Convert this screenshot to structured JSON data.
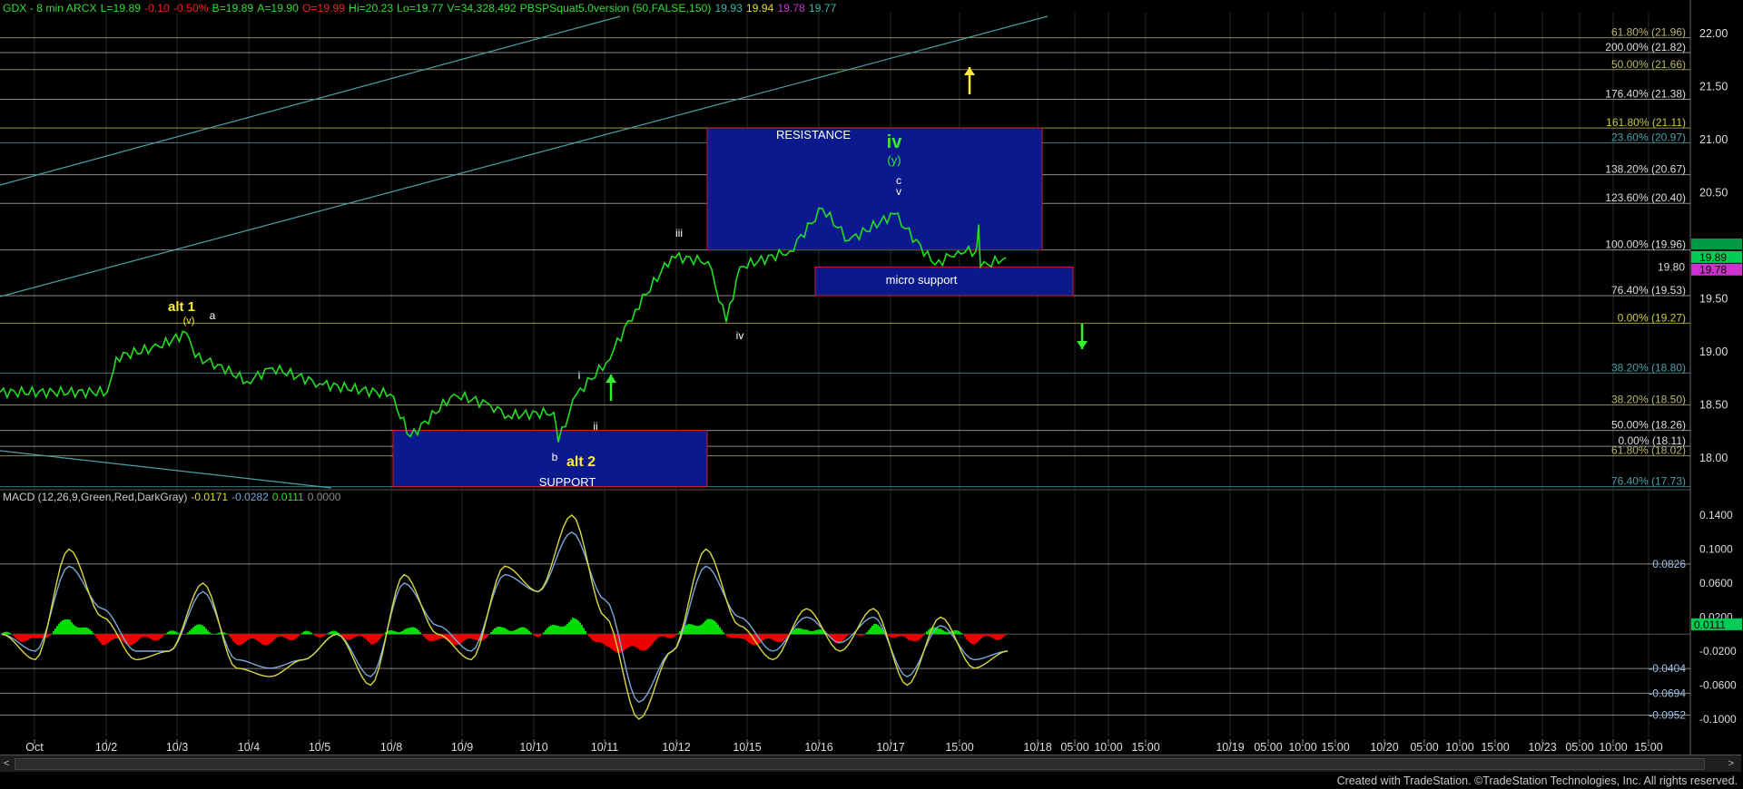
{
  "header": {
    "symbol": "GDX - 8 min  ARCX",
    "last": "L=19.89",
    "change": "-0.10",
    "change_pct": "-0.50%",
    "bid": "B=19.89",
    "ask": "A=19.90",
    "open": "O=19.99",
    "high": "Hi=20.23",
    "low": "Lo=19.77",
    "volume": "V=34,328,492",
    "study": "PBSPSquat5.0version (50,FALSE,150)",
    "study_v1": "19.93",
    "study_v2": "19.94",
    "study_v3": "19.78",
    "study_v4": "19.77"
  },
  "macd_header": {
    "label": "MACD (12,26,9,Green,Red,DarkGray)",
    "v1": "-0.0171",
    "v2": "-0.0282",
    "v3": "0.0111",
    "v4": "0.0000"
  },
  "footer": "Created with TradeStation. ©TradeStation Technologies, Inc. All rights reserved.",
  "scrollbar": {
    "left": "<",
    "right": ">"
  },
  "colors": {
    "background": "#000000",
    "price": "#22dd22",
    "box": "#0a1a8c",
    "box_border": "#cc2222",
    "label_yellow": "#ffee33",
    "label_green": "#33ee33",
    "fib_khaki": "#b8b870",
    "fib_cyan": "#4aa0a8",
    "macd_line": "#d8d840",
    "signal_line": "#7aa7d8",
    "hist_pos": "#00dd00",
    "hist_neg": "#ee0000"
  },
  "chart_data": [
    {
      "type": "line",
      "name": "price",
      "x_ticks": [
        "Oct",
        "10/2",
        "10/3",
        "10/4",
        "10/5",
        "10/8",
        "10/9",
        "10/10",
        "10/11",
        "10/12",
        "10/15",
        "10/16",
        "10/17",
        "15:00",
        "10/18",
        "05:00",
        "10:00",
        "15:00",
        "10/19",
        "05:00",
        "10:00",
        "15:00",
        "10/20",
        "05:00",
        "10:00",
        "15:00",
        "10/23",
        "05:00",
        "10:00",
        "15:00"
      ],
      "y_ticks": [
        18.0,
        18.5,
        19.0,
        19.5,
        20.0,
        20.5,
        21.0,
        21.5,
        22.0
      ],
      "ylim": [
        17.73,
        22.1
      ],
      "last_price": 19.89,
      "price_tags": [
        {
          "label": "19.89",
          "color": "#00cc55"
        },
        {
          "label": "19.78",
          "color": "#cc33cc"
        },
        {
          "label": "19.80",
          "color": "#000000"
        }
      ],
      "path_points": [
        {
          "x": "Oct",
          "y": 18.62
        },
        {
          "x": "10/2",
          "y": 18.62
        },
        {
          "x": "10/2",
          "y": 18.95
        },
        {
          "x": "10/3",
          "y": 19.05
        },
        {
          "x": "10/3",
          "y": 19.18
        },
        {
          "x": "10/3",
          "y": 18.95
        },
        {
          "x": "10/4",
          "y": 18.88
        },
        {
          "x": "10/4",
          "y": 18.72
        },
        {
          "x": "10/5",
          "y": 18.85
        },
        {
          "x": "10/5",
          "y": 18.7
        },
        {
          "x": "10/8",
          "y": 18.6
        },
        {
          "x": "10/8",
          "y": 18.2
        },
        {
          "x": "10/8",
          "y": 18.6
        },
        {
          "x": "10/9",
          "y": 18.5
        },
        {
          "x": "10/9",
          "y": 18.4
        },
        {
          "x": "10/10",
          "y": 18.43
        },
        {
          "x": "10/10",
          "y": 18.15
        },
        {
          "x": "10/10",
          "y": 18.6
        },
        {
          "x": "10/11",
          "y": 18.9
        },
        {
          "x": "10/11",
          "y": 19.4
        },
        {
          "x": "10/11",
          "y": 19.9
        },
        {
          "x": "10/12",
          "y": 19.85
        },
        {
          "x": "10/12",
          "y": 19.28
        },
        {
          "x": "10/12",
          "y": 19.8
        },
        {
          "x": "10/15",
          "y": 19.95
        },
        {
          "x": "10/15",
          "y": 20.35
        },
        {
          "x": "10/15",
          "y": 20.05
        },
        {
          "x": "10/16",
          "y": 20.3
        },
        {
          "x": "10/16",
          "y": 19.82
        },
        {
          "x": "10/16",
          "y": 19.95
        },
        {
          "x": "10/17",
          "y": 19.95
        },
        {
          "x": "10/17",
          "y": 20.2
        },
        {
          "x": "10/17",
          "y": 19.8
        },
        {
          "x": "15:00",
          "y": 19.89
        }
      ],
      "fib_levels": [
        {
          "label": "61.80% (21.96)",
          "value": 21.96,
          "color": "#b8b870"
        },
        {
          "label": "200.00% (21.82)",
          "value": 21.82,
          "color": "#ffffff"
        },
        {
          "label": "50.00% (21.66)",
          "value": 21.66,
          "color": "#b8b870"
        },
        {
          "label": "176.40% (21.38)",
          "value": 21.38,
          "color": "#ffffff"
        },
        {
          "label": "161.80% (21.11)",
          "value": 21.11,
          "color": "#cccc44"
        },
        {
          "label": "23.60% (20.97)",
          "value": 20.97,
          "color": "#4aa0a8"
        },
        {
          "label": "138.20% (20.67)",
          "value": 20.67,
          "color": "#ffffff"
        },
        {
          "label": "123.60% (20.40)",
          "value": 20.4,
          "color": "#ffffff"
        },
        {
          "label": "100.00% (19.96)",
          "value": 19.96,
          "color": "#ffffff"
        },
        {
          "label": "76.40% (19.53)",
          "value": 19.53,
          "color": "#ffffff"
        },
        {
          "label": "0.00% (19.27)",
          "value": 19.27,
          "color": "#cccc44"
        },
        {
          "label": "38.20% (18.80)",
          "value": 18.8,
          "color": "#4aa0a8"
        },
        {
          "label": "38.20% (18.50)",
          "value": 18.5,
          "color": "#b8b870"
        },
        {
          "label": "50.00% (18.26)",
          "value": 18.26,
          "color": "#ffffff"
        },
        {
          "label": "0.00% (18.11)",
          "value": 18.11,
          "color": "#ffffff"
        },
        {
          "label": "61.80% (18.02)",
          "value": 18.02,
          "color": "#b8b870"
        },
        {
          "label": "76.40% (17.73)",
          "value": 17.73,
          "color": "#4aa0a8"
        }
      ],
      "zones": [
        {
          "label": "RESISTANCE",
          "x": [
            "10/12",
            "10/17"
          ],
          "y": [
            19.96,
            21.11
          ]
        },
        {
          "label": "micro support",
          "x": [
            "10/15",
            "10/17"
          ],
          "y": [
            19.53,
            19.8
          ]
        },
        {
          "label": "SUPPORT",
          "x": [
            "10/8",
            "10/12"
          ],
          "y": [
            17.73,
            18.26
          ]
        }
      ],
      "wave_labels": [
        {
          "text": "alt 1",
          "color": "#ffee33",
          "x": "10/3",
          "y": 19.35
        },
        {
          "text": "(v)",
          "color": "#ffee33",
          "x": "10/3",
          "y": 19.2
        },
        {
          "text": "a",
          "color": "#ffffff",
          "x": "10/3",
          "y": 19.25
        },
        {
          "text": "iii",
          "color": "#ffffff",
          "x": "10/11",
          "y": 20.05
        },
        {
          "text": "iv",
          "color": "#33ee33",
          "x": "10/16",
          "y": 20.9
        },
        {
          "text": "(y)",
          "color": "#33ee33",
          "x": "10/16",
          "y": 20.75
        },
        {
          "text": "c",
          "color": "#ffffff",
          "x": "10/16",
          "y": 20.6
        },
        {
          "text": "v",
          "color": "#ffffff",
          "x": "10/16",
          "y": 20.48
        },
        {
          "text": "iv",
          "color": "#ffffff",
          "x": "10/12",
          "y": 19.1
        },
        {
          "text": "i",
          "color": "#ffffff",
          "x": "10/10",
          "y": 18.75
        },
        {
          "text": "ii",
          "color": "#ffffff",
          "x": "10/11",
          "y": 18.3
        },
        {
          "text": "b",
          "color": "#ffffff",
          "x": "10/10",
          "y": 18.0
        },
        {
          "text": "alt 2",
          "color": "#ffee33",
          "x": "10/10",
          "y": 17.95
        },
        {
          "text": "RESISTANCE",
          "color": "#ffffff",
          "x": "10/12",
          "y": 21.05
        },
        {
          "text": "micro support",
          "color": "#ffffff",
          "x": "10/16",
          "y": 19.63
        },
        {
          "text": "SUPPORT",
          "color": "#ffffff",
          "x": "10/10",
          "y": 17.78
        }
      ]
    },
    {
      "type": "line",
      "name": "MACD",
      "y_ticks": [
        0.14,
        0.1,
        0.06,
        0.02,
        -0.02,
        -0.06,
        -0.1
      ],
      "y_tick_labels": [
        "0.1400",
        "0.1000",
        "0.0600",
        "0.0200",
        "-0.0200",
        "-0.0600",
        "-0.1000"
      ],
      "ylim": [
        -0.11,
        0.15
      ],
      "ref_lines": [
        0.0826,
        -0.0404,
        -0.0694,
        -0.0952
      ],
      "ref_labels": [
        "0.0826",
        "-0.0404",
        "-0.0694",
        "-0.0952"
      ],
      "current_value": "0.0111",
      "series": [
        {
          "role": "macd",
          "values": [
            0.0,
            -0.03,
            0.1,
            0.02,
            -0.03,
            -0.02,
            0.06,
            -0.04,
            -0.05,
            -0.03,
            0.0,
            -0.06,
            0.07,
            0.0,
            -0.03,
            0.08,
            0.05,
            0.14,
            0.02,
            -0.1,
            -0.02,
            0.1,
            0.01,
            -0.03,
            0.03,
            -0.02,
            0.03,
            -0.06,
            0.02,
            -0.04,
            -0.02
          ]
        },
        {
          "role": "signal",
          "values": [
            0.0,
            -0.02,
            0.08,
            0.03,
            -0.02,
            -0.02,
            0.05,
            -0.03,
            -0.04,
            -0.03,
            0.0,
            -0.05,
            0.06,
            0.01,
            -0.02,
            0.07,
            0.05,
            0.12,
            0.04,
            -0.08,
            -0.02,
            0.08,
            0.02,
            -0.02,
            0.02,
            -0.01,
            0.02,
            -0.05,
            0.01,
            -0.03,
            -0.02
          ]
        }
      ]
    }
  ]
}
